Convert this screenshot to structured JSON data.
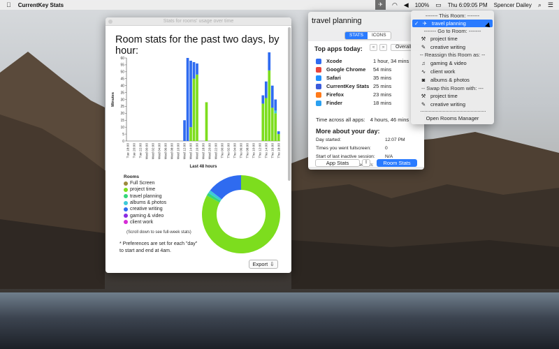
{
  "menubar": {
    "app_name": "CurrentKey Stats",
    "battery": "100%",
    "datetime": "Thu 6:09:05 PM",
    "user": "Spencer Dailey",
    "icons": [
      "apple-icon",
      "airplane-icon",
      "wifi-icon",
      "volume-icon",
      "battery-icon",
      "search-icon",
      "list-icon"
    ]
  },
  "stats_window": {
    "title": "Stats for rooms' usage over time",
    "heading": "Room stats for the past two days, by hour:",
    "legend_title": "Rooms",
    "scroll_note": "(Scroll down to see full-week stats)",
    "pref_note_1": "* Preferences are set for each \"day\"",
    "pref_note_2": "to start and end at 4am.",
    "export_label": "Export"
  },
  "chart_data": [
    {
      "type": "bar",
      "stacked": true,
      "title": "",
      "xlabel": "Last 48 hours",
      "ylabel": "Minutes",
      "ylim": [
        0,
        60
      ],
      "yticks": [
        0,
        5,
        10,
        15,
        20,
        25,
        30,
        35,
        40,
        45,
        50,
        55,
        60
      ],
      "categories": [
        "Tue 18:00",
        "Tue 19:00",
        "Tue 20:00",
        "Tue 21:00",
        "Tue 22:00",
        "Tue 23:00",
        "Wed 00:00",
        "Wed 01:00",
        "Wed 02:00",
        "Wed 03:00",
        "Wed 04:00",
        "Wed 05:00",
        "Wed 06:00",
        "Wed 07:00",
        "Wed 08:00",
        "Wed 09:00",
        "Wed 10:00",
        "Wed 11:00",
        "Wed 12:00",
        "Wed 13:00",
        "Wed 14:00",
        "Wed 15:00",
        "Wed 16:00",
        "Wed 17:00",
        "Wed 18:00",
        "Wed 19:00",
        "Wed 20:00",
        "Wed 21:00",
        "Wed 22:00",
        "Wed 23:00",
        "Thu 00:00",
        "Thu 01:00",
        "Thu 02:00",
        "Thu 03:00",
        "Thu 04:00",
        "Thu 05:00",
        "Thu 06:00",
        "Thu 07:00",
        "Thu 08:00",
        "Thu 09:00",
        "Thu 10:00",
        "Thu 11:00",
        "Thu 12:00",
        "Thu 13:00",
        "Thu 14:00",
        "Thu 15:00",
        "Thu 16:00",
        "Thu 17:00",
        "Thu 18:00"
      ],
      "tick_labels": [
        "Tue 18:00",
        "Tue 20:00",
        "Tue 22:00",
        "Wed 00:00",
        "Wed 02:00",
        "Wed 04:00",
        "Wed 06:00",
        "Wed 08:00",
        "Wed 10:00",
        "Wed 12:00",
        "Wed 14:00",
        "Wed 16:00",
        "Wed 18:00",
        "Wed 20:00",
        "Wed 22:00",
        "Thu 00:00",
        "Thu 02:00",
        "Thu 04:00",
        "Thu 06:00",
        "Thu 08:00",
        "Thu 10:00",
        "Thu 12:00",
        "Thu 14:00",
        "Thu 16:00",
        "Thu 18:00"
      ],
      "series": [
        {
          "name": "Full Screen",
          "color": "#9c8a3c",
          "values": [
            0,
            0,
            0,
            0,
            0,
            0,
            0,
            0,
            0,
            0,
            0,
            0,
            0,
            0,
            0,
            0,
            0,
            0,
            0,
            0,
            0,
            0,
            0,
            0,
            0,
            0,
            0,
            0,
            0,
            0,
            0,
            0,
            0,
            0,
            0,
            0,
            0,
            0,
            0,
            0,
            0,
            0,
            0,
            0,
            0,
            0,
            0,
            0,
            0
          ]
        },
        {
          "name": "project time",
          "color": "#7ddd1e",
          "values": [
            0,
            0,
            0,
            0,
            0,
            0,
            0,
            0,
            0,
            0,
            0,
            0,
            0,
            0,
            0,
            0,
            0,
            0,
            0,
            0,
            10,
            45,
            48,
            0,
            0,
            28,
            0,
            0,
            0,
            0,
            0,
            0,
            0,
            0,
            0,
            0,
            0,
            0,
            0,
            0,
            0,
            0,
            0,
            27,
            31,
            51,
            24,
            20,
            5
          ]
        },
        {
          "name": "travel planning",
          "color": "#34d67a",
          "values": [
            0,
            0,
            0,
            0,
            0,
            0,
            0,
            0,
            0,
            0,
            0,
            0,
            0,
            0,
            0,
            0,
            0,
            0,
            0,
            0,
            0,
            0,
            0,
            0,
            0,
            0,
            0,
            0,
            0,
            0,
            0,
            0,
            0,
            0,
            0,
            0,
            0,
            0,
            0,
            0,
            0,
            0,
            0,
            0,
            0,
            0,
            0,
            0,
            0
          ]
        },
        {
          "name": "albums & photos",
          "color": "#3ec9d8",
          "values": [
            0,
            0,
            0,
            0,
            0,
            0,
            0,
            0,
            0,
            0,
            0,
            0,
            0,
            0,
            0,
            0,
            0,
            0,
            0,
            0,
            0,
            0,
            0,
            0,
            0,
            0,
            0,
            0,
            0,
            0,
            0,
            0,
            0,
            0,
            0,
            0,
            0,
            0,
            0,
            0,
            0,
            0,
            0,
            0,
            0,
            0,
            0,
            2,
            0
          ]
        },
        {
          "name": "creative writing",
          "color": "#2f6bf0",
          "values": [
            0,
            0,
            0,
            0,
            0,
            0,
            0,
            0,
            0,
            0,
            0,
            0,
            0,
            0,
            0,
            0,
            0,
            0,
            15,
            60,
            48,
            12,
            8,
            0,
            0,
            0,
            0,
            0,
            0,
            0,
            0,
            0,
            0,
            0,
            0,
            0,
            0,
            0,
            0,
            0,
            0,
            0,
            0,
            6,
            12,
            14,
            16,
            8,
            2
          ]
        },
        {
          "name": "gaming & video",
          "color": "#8a2be2",
          "values": [
            0,
            0,
            0,
            0,
            0,
            0,
            0,
            0,
            0,
            0,
            0,
            0,
            0,
            0,
            0,
            0,
            0,
            0,
            0,
            0,
            0,
            0,
            0,
            0,
            0,
            0,
            0,
            0,
            0,
            0,
            0,
            0,
            0,
            0,
            0,
            0,
            0,
            0,
            0,
            0,
            0,
            0,
            0,
            0,
            0,
            0,
            0,
            0,
            0
          ]
        },
        {
          "name": "client work",
          "color": "#d62bd6",
          "values": [
            0,
            0,
            0,
            0,
            0,
            0,
            0,
            0,
            0,
            0,
            0,
            0,
            0,
            0,
            0,
            0,
            0,
            0,
            0,
            0,
            0,
            0,
            0,
            0,
            0,
            0,
            0,
            0,
            0,
            0,
            0,
            0,
            0,
            0,
            0,
            0,
            0,
            0,
            0,
            0,
            0,
            0,
            0,
            0,
            0,
            0,
            0,
            0,
            0
          ]
        }
      ]
    },
    {
      "type": "pie",
      "donut": true,
      "title": "",
      "slices": [
        {
          "name": "project time",
          "color": "#7ddd1e",
          "value": 83
        },
        {
          "name": "travel planning",
          "color": "#34d67a",
          "value": 1.2
        },
        {
          "name": "albums & photos",
          "color": "#3ec9d8",
          "value": 1.3
        },
        {
          "name": "creative writing",
          "color": "#2f6bf0",
          "value": 14.5
        }
      ]
    }
  ],
  "popover": {
    "title": "travel planning",
    "tabs": [
      "STATS",
      "ICONS"
    ],
    "top_apps_label": "Top apps today:",
    "prev_label": "«",
    "next_label": "»",
    "overall_label": "Overall",
    "apps": [
      {
        "name": "Xcode",
        "time": "1 hour, 34 mins",
        "color": "#2f6bf0"
      },
      {
        "name": "Google Chrome",
        "time": "54 mins",
        "color": "#e8453c"
      },
      {
        "name": "Safari",
        "time": "35 mins",
        "color": "#1e90ff"
      },
      {
        "name": "CurrentKey Stats",
        "time": "25 mins",
        "color": "#3b5bdb"
      },
      {
        "name": "Firefox",
        "time": "23 mins",
        "color": "#ff7a1a"
      },
      {
        "name": "Finder",
        "time": "18 mins",
        "color": "#2aa0f0"
      }
    ],
    "across_label": "Time across all apps:",
    "across_value": "4 hours, 46 mins",
    "more_label": "More about your day:",
    "info": [
      {
        "k": "Day started:",
        "v": "12:07 PM"
      },
      {
        "k": "Times you went fullscreen:",
        "v": "0"
      },
      {
        "k": "Start of last inactive session:",
        "v": "N/A"
      },
      {
        "k": "End of last inactive session:",
        "v": "5:27 PM"
      }
    ],
    "app_stats_label": "App Stats",
    "room_stats_label": "Room Stats"
  },
  "menu": {
    "this_room_header": "-------  This Room:  -------",
    "current_room": "travel planning",
    "go_to_header": "-------  Go to Room:  -------",
    "go_to_rooms": [
      {
        "label": "project time",
        "icon": "hammer-icon",
        "glyph": "⚒"
      },
      {
        "label": "creative writing",
        "icon": "edit-icon",
        "glyph": "✎"
      }
    ],
    "reassign_header": "-- Reassign this Room as: --",
    "reassign_rooms": [
      {
        "label": "gaming & video",
        "icon": "headphones-icon",
        "glyph": "🎧"
      },
      {
        "label": "client work",
        "icon": "activity-icon",
        "glyph": "〰"
      },
      {
        "label": "albums & photos",
        "icon": "camera-icon",
        "glyph": "📷"
      }
    ],
    "swap_header": "-- Swap this Room with: ---",
    "swap_rooms": [
      {
        "label": "project time",
        "icon": "hammer-icon",
        "glyph": "⚒"
      },
      {
        "label": "creative writing",
        "icon": "edit-icon",
        "glyph": "✎"
      }
    ],
    "manager_label": "Open Rooms Manager"
  }
}
